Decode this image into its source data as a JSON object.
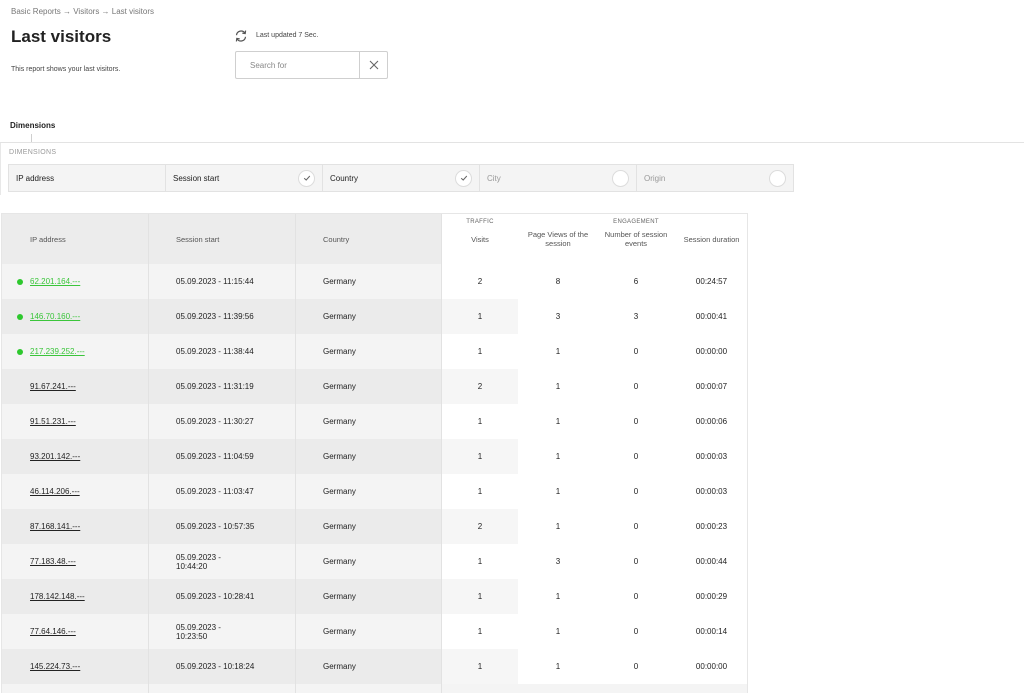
{
  "breadcrumb": "Basic Reports → Visitors → Last visitors",
  "title": "Last visitors",
  "description": "This report shows your last visitors.",
  "last_updated": "Last updated 7 Sec.",
  "search": {
    "placeholder": "Search for",
    "value": ""
  },
  "dimensions_tab": "Dimensions",
  "dimensions_caption": "DIMENSIONS",
  "dimensions": [
    {
      "label": "IP address",
      "active": true,
      "toggle": "none"
    },
    {
      "label": "Session start",
      "active": true,
      "toggle": "check-icon"
    },
    {
      "label": "Country",
      "active": true,
      "toggle": "check-icon"
    },
    {
      "label": "City",
      "active": false,
      "toggle": "empty-circle"
    },
    {
      "label": "Origin",
      "active": false,
      "toggle": "empty-circle"
    }
  ],
  "table": {
    "group_traffic": "TRAFFIC",
    "group_engagement": "ENGAGEMENT",
    "headers": {
      "ip": "IP address",
      "session_start": "Session start",
      "country": "Country",
      "visits": "Visits",
      "page_views": "Page Views of the session",
      "events": "Number of session events",
      "duration": "Session duration"
    },
    "rows": [
      {
        "ip": "62.201.164.---",
        "online": true,
        "session_start": "05.09.2023 - 11:15:44",
        "country": "Germany",
        "visits": "2",
        "page_views": "8",
        "events": "6",
        "duration": "00:24:57"
      },
      {
        "ip": "146.70.160.---",
        "online": true,
        "session_start": "05.09.2023 - 11:39:56",
        "country": "Germany",
        "visits": "1",
        "page_views": "3",
        "events": "3",
        "duration": "00:00:41"
      },
      {
        "ip": "217.239.252.---",
        "online": true,
        "session_start": "05.09.2023 - 11:38:44",
        "country": "Germany",
        "visits": "1",
        "page_views": "1",
        "events": "0",
        "duration": "00:00:00"
      },
      {
        "ip": "91.67.241.---",
        "online": false,
        "session_start": "05.09.2023 - 11:31:19",
        "country": "Germany",
        "visits": "2",
        "page_views": "1",
        "events": "0",
        "duration": "00:00:07"
      },
      {
        "ip": "91.51.231.---",
        "online": false,
        "session_start": "05.09.2023 - 11:30:27",
        "country": "Germany",
        "visits": "1",
        "page_views": "1",
        "events": "0",
        "duration": "00:00:06"
      },
      {
        "ip": "93.201.142.---",
        "online": false,
        "session_start": "05.09.2023 - 11:04:59",
        "country": "Germany",
        "visits": "1",
        "page_views": "1",
        "events": "0",
        "duration": "00:00:03"
      },
      {
        "ip": "46.114.206.---",
        "online": false,
        "session_start": "05.09.2023 - 11:03:47",
        "country": "Germany",
        "visits": "1",
        "page_views": "1",
        "events": "0",
        "duration": "00:00:03"
      },
      {
        "ip": "87.168.141.---",
        "online": false,
        "session_start": "05.09.2023 - 10:57:35",
        "country": "Germany",
        "visits": "2",
        "page_views": "1",
        "events": "0",
        "duration": "00:00:23"
      },
      {
        "ip": "77.183.48.---",
        "online": false,
        "session_start": "05.09.2023 - 10:44:20",
        "country": "Germany",
        "visits": "1",
        "page_views": "3",
        "events": "0",
        "duration": "00:00:44",
        "wrap": true
      },
      {
        "ip": "178.142.148.---",
        "online": false,
        "session_start": "05.09.2023 - 10:28:41",
        "country": "Germany",
        "visits": "1",
        "page_views": "1",
        "events": "0",
        "duration": "00:00:29"
      },
      {
        "ip": "77.64.146.---",
        "online": false,
        "session_start": "05.09.2023 - 10:23:50",
        "country": "Germany",
        "visits": "1",
        "page_views": "1",
        "events": "0",
        "duration": "00:00:14",
        "wrap": true
      },
      {
        "ip": "145.224.73.---",
        "online": false,
        "session_start": "05.09.2023 - 10:18:24",
        "country": "Germany",
        "visits": "1",
        "page_views": "1",
        "events": "0",
        "duration": "00:00:00"
      }
    ]
  },
  "colors": {
    "online": "#2ec82e",
    "row_light": "#f4f4f4",
    "row_dark": "#ebebeb"
  }
}
